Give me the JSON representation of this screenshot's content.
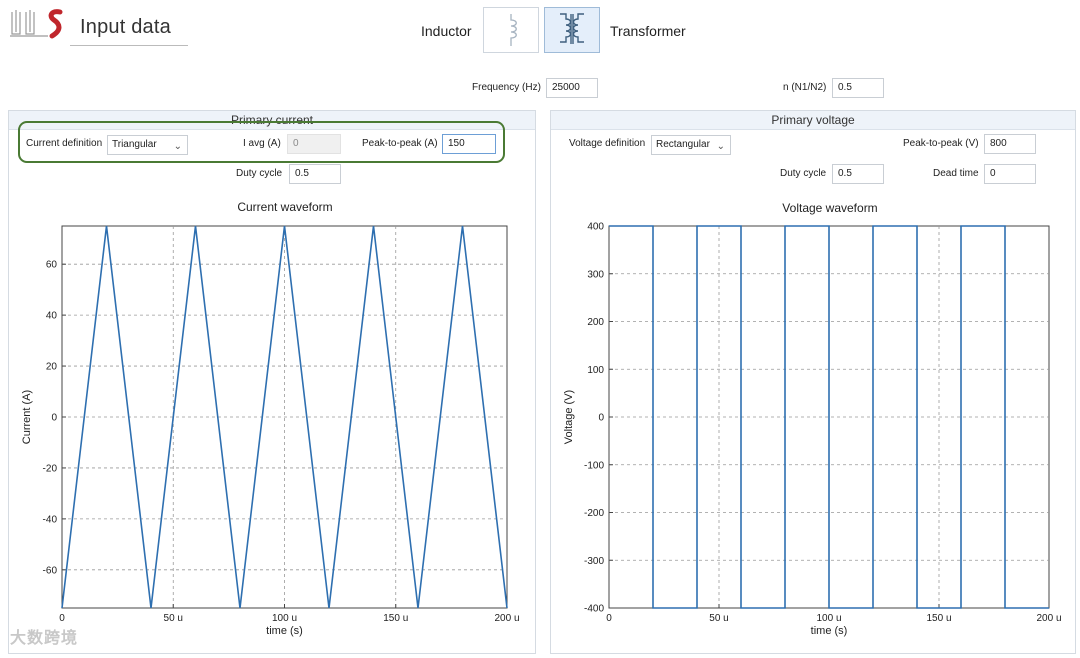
{
  "app": {
    "title": "Input data"
  },
  "mode": {
    "inductor_label": "Inductor",
    "transformer_label": "Transformer",
    "selected": "Transformer"
  },
  "global": {
    "frequency_label": "Frequency (Hz)",
    "frequency_value": "25000",
    "ratio_label": "n (N1/N2)",
    "ratio_value": "0.5"
  },
  "primary_current": {
    "title": "Primary current",
    "definition_label": "Current definition",
    "definition_value": "Triangular",
    "iavg_label": "I avg (A)",
    "iavg_value": "0",
    "p2p_label": "Peak-to-peak (A)",
    "p2p_value": "150",
    "duty_label": "Duty cycle",
    "duty_value": "0.5"
  },
  "primary_voltage": {
    "title": "Primary voltage",
    "definition_label": "Voltage definition",
    "definition_value": "Rectangular",
    "p2p_label": "Peak-to-peak (V)",
    "p2p_value": "800",
    "duty_label": "Duty cycle",
    "duty_value": "0.5",
    "deadtime_label": "Dead time",
    "deadtime_value": "0"
  },
  "watermark": "大数跨境",
  "colors": {
    "series": "#2e6fb0",
    "highlight": "#4a7a34",
    "header_bg": "#eef3f9"
  },
  "chart_data": [
    {
      "type": "line",
      "title": "Current waveform",
      "xlabel": "time (s)",
      "ylabel": "Current (A)",
      "xlim": [
        0,
        200
      ],
      "ylim": [
        -75,
        75
      ],
      "xticks": [
        "0",
        "50 u",
        "100 u",
        "150 u",
        "200 u"
      ],
      "xtick_values": [
        0,
        50,
        100,
        150,
        200
      ],
      "yticks": [
        "60",
        "40",
        "20",
        "0",
        "-20",
        "-40",
        "-60"
      ],
      "ytick_values": [
        60,
        40,
        20,
        0,
        -20,
        -40,
        -60
      ],
      "grid": true,
      "series": [
        {
          "x": [
            0,
            20,
            40,
            60,
            80,
            100,
            120,
            140,
            160,
            180,
            200
          ],
          "y": [
            -75,
            75,
            -75,
            75,
            -75,
            75,
            -75,
            75,
            -75,
            75,
            -75
          ]
        }
      ]
    },
    {
      "type": "line",
      "title": "Voltage waveform",
      "xlabel": "time (s)",
      "ylabel": "Voltage (V)",
      "xlim": [
        0,
        200
      ],
      "ylim": [
        -400,
        400
      ],
      "xticks": [
        "0",
        "50 u",
        "100 u",
        "150 u",
        "200 u"
      ],
      "xtick_values": [
        0,
        50,
        100,
        150,
        200
      ],
      "yticks": [
        "400",
        "300",
        "200",
        "100",
        "0",
        "-100",
        "-200",
        "-300",
        "-400"
      ],
      "ytick_values": [
        400,
        300,
        200,
        100,
        0,
        -100,
        -200,
        -300,
        -400
      ],
      "grid": true,
      "series": [
        {
          "x": [
            0,
            20,
            20,
            40,
            40,
            60,
            60,
            80,
            80,
            100,
            100,
            120,
            120,
            140,
            140,
            160,
            160,
            180,
            180,
            200
          ],
          "y": [
            400,
            400,
            -400,
            -400,
            400,
            400,
            -400,
            -400,
            400,
            400,
            -400,
            -400,
            400,
            400,
            -400,
            -400,
            400,
            400,
            -400,
            -400
          ]
        }
      ]
    }
  ]
}
